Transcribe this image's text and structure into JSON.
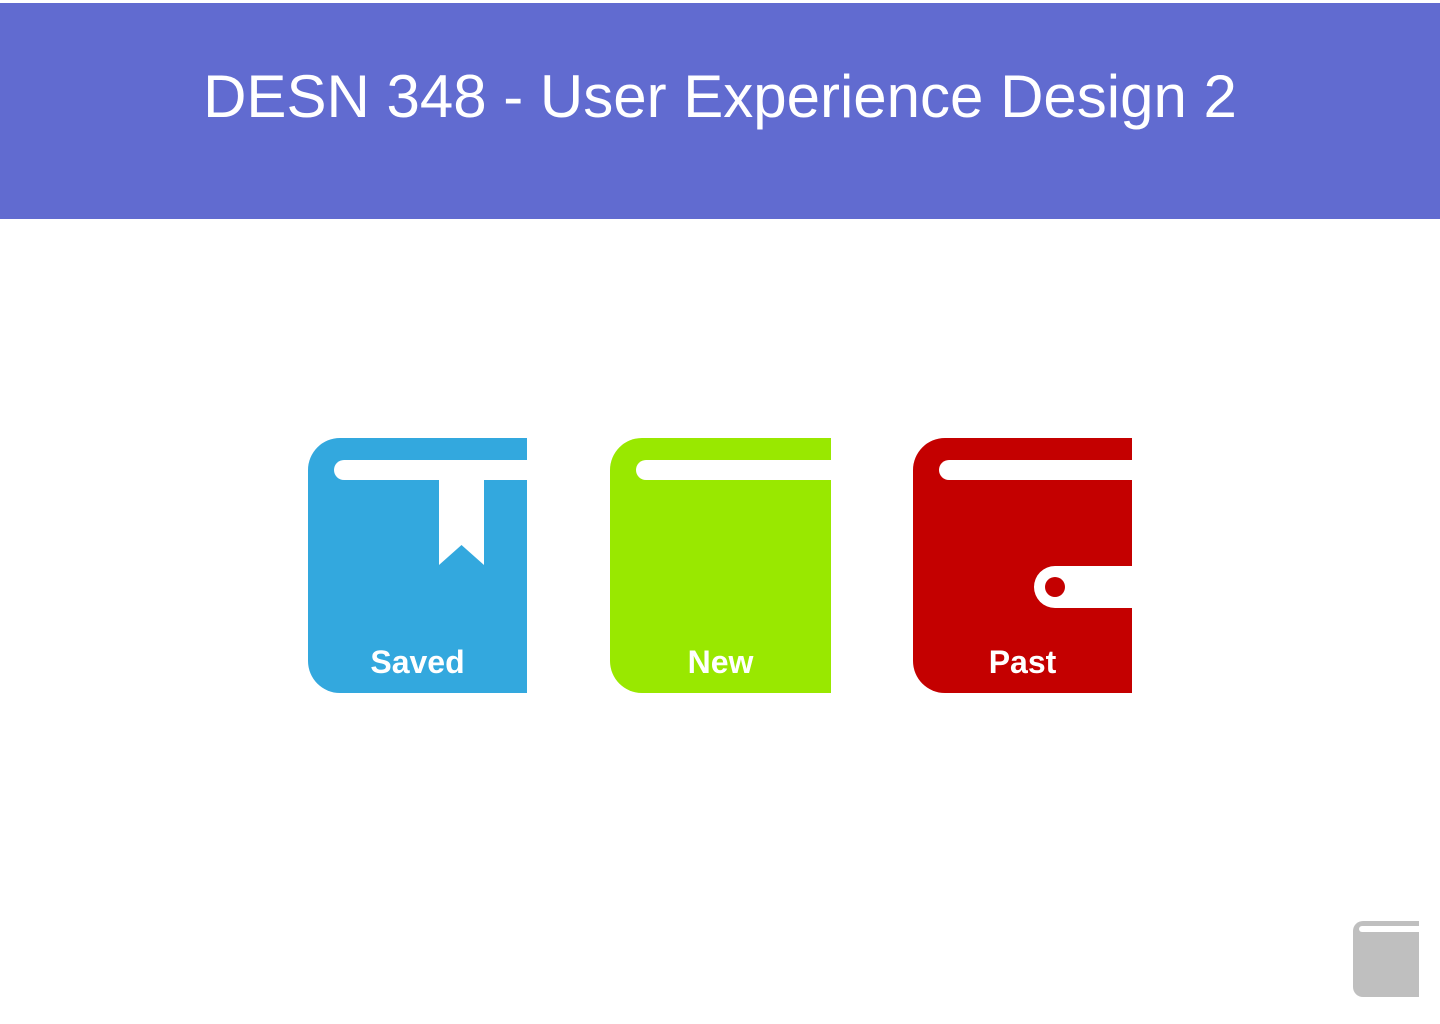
{
  "header": {
    "title": "DESN 348 - User Experience Design 2",
    "background": "#616bd0"
  },
  "tiles": [
    {
      "label": "Saved",
      "icon": "bookmark-book-icon",
      "color": "#33a8de"
    },
    {
      "label": "New",
      "icon": "book-icon",
      "color": "#99e800"
    },
    {
      "label": "Past",
      "icon": "wallet-book-icon",
      "color": "#c40000"
    }
  ],
  "corner": {
    "icon": "book-icon",
    "color": "#bfbfbf"
  }
}
